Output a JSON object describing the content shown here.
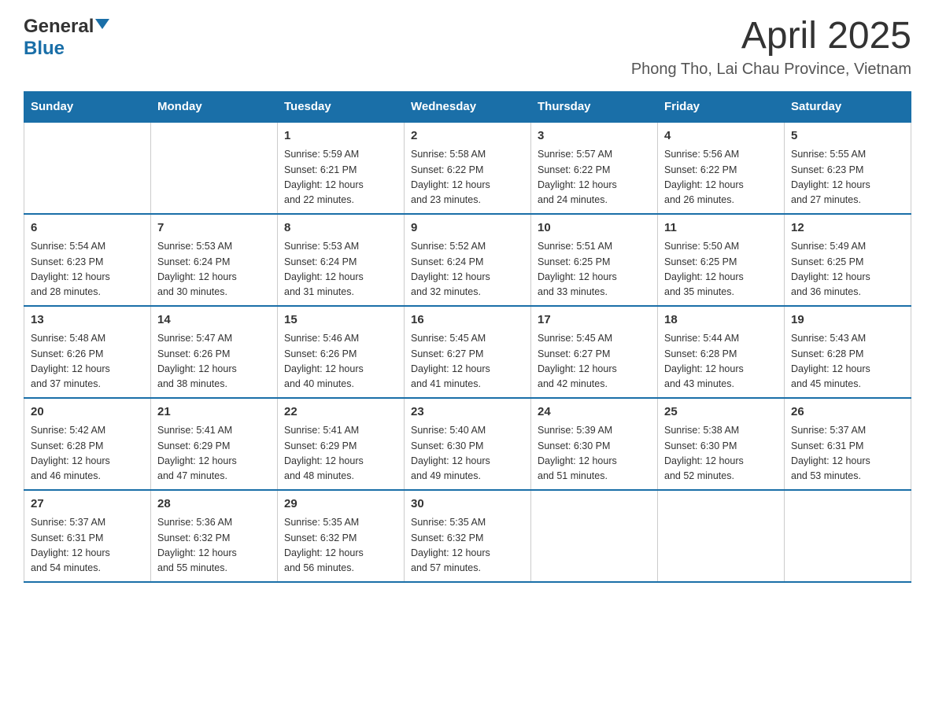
{
  "header": {
    "logo_general": "General",
    "logo_blue": "Blue",
    "title": "April 2025",
    "subtitle": "Phong Tho, Lai Chau Province, Vietnam"
  },
  "days_of_week": [
    "Sunday",
    "Monday",
    "Tuesday",
    "Wednesday",
    "Thursday",
    "Friday",
    "Saturday"
  ],
  "weeks": [
    {
      "days": [
        {
          "number": "",
          "info": ""
        },
        {
          "number": "",
          "info": ""
        },
        {
          "number": "1",
          "info": "Sunrise: 5:59 AM\nSunset: 6:21 PM\nDaylight: 12 hours\nand 22 minutes."
        },
        {
          "number": "2",
          "info": "Sunrise: 5:58 AM\nSunset: 6:22 PM\nDaylight: 12 hours\nand 23 minutes."
        },
        {
          "number": "3",
          "info": "Sunrise: 5:57 AM\nSunset: 6:22 PM\nDaylight: 12 hours\nand 24 minutes."
        },
        {
          "number": "4",
          "info": "Sunrise: 5:56 AM\nSunset: 6:22 PM\nDaylight: 12 hours\nand 26 minutes."
        },
        {
          "number": "5",
          "info": "Sunrise: 5:55 AM\nSunset: 6:23 PM\nDaylight: 12 hours\nand 27 minutes."
        }
      ]
    },
    {
      "days": [
        {
          "number": "6",
          "info": "Sunrise: 5:54 AM\nSunset: 6:23 PM\nDaylight: 12 hours\nand 28 minutes."
        },
        {
          "number": "7",
          "info": "Sunrise: 5:53 AM\nSunset: 6:24 PM\nDaylight: 12 hours\nand 30 minutes."
        },
        {
          "number": "8",
          "info": "Sunrise: 5:53 AM\nSunset: 6:24 PM\nDaylight: 12 hours\nand 31 minutes."
        },
        {
          "number": "9",
          "info": "Sunrise: 5:52 AM\nSunset: 6:24 PM\nDaylight: 12 hours\nand 32 minutes."
        },
        {
          "number": "10",
          "info": "Sunrise: 5:51 AM\nSunset: 6:25 PM\nDaylight: 12 hours\nand 33 minutes."
        },
        {
          "number": "11",
          "info": "Sunrise: 5:50 AM\nSunset: 6:25 PM\nDaylight: 12 hours\nand 35 minutes."
        },
        {
          "number": "12",
          "info": "Sunrise: 5:49 AM\nSunset: 6:25 PM\nDaylight: 12 hours\nand 36 minutes."
        }
      ]
    },
    {
      "days": [
        {
          "number": "13",
          "info": "Sunrise: 5:48 AM\nSunset: 6:26 PM\nDaylight: 12 hours\nand 37 minutes."
        },
        {
          "number": "14",
          "info": "Sunrise: 5:47 AM\nSunset: 6:26 PM\nDaylight: 12 hours\nand 38 minutes."
        },
        {
          "number": "15",
          "info": "Sunrise: 5:46 AM\nSunset: 6:26 PM\nDaylight: 12 hours\nand 40 minutes."
        },
        {
          "number": "16",
          "info": "Sunrise: 5:45 AM\nSunset: 6:27 PM\nDaylight: 12 hours\nand 41 minutes."
        },
        {
          "number": "17",
          "info": "Sunrise: 5:45 AM\nSunset: 6:27 PM\nDaylight: 12 hours\nand 42 minutes."
        },
        {
          "number": "18",
          "info": "Sunrise: 5:44 AM\nSunset: 6:28 PM\nDaylight: 12 hours\nand 43 minutes."
        },
        {
          "number": "19",
          "info": "Sunrise: 5:43 AM\nSunset: 6:28 PM\nDaylight: 12 hours\nand 45 minutes."
        }
      ]
    },
    {
      "days": [
        {
          "number": "20",
          "info": "Sunrise: 5:42 AM\nSunset: 6:28 PM\nDaylight: 12 hours\nand 46 minutes."
        },
        {
          "number": "21",
          "info": "Sunrise: 5:41 AM\nSunset: 6:29 PM\nDaylight: 12 hours\nand 47 minutes."
        },
        {
          "number": "22",
          "info": "Sunrise: 5:41 AM\nSunset: 6:29 PM\nDaylight: 12 hours\nand 48 minutes."
        },
        {
          "number": "23",
          "info": "Sunrise: 5:40 AM\nSunset: 6:30 PM\nDaylight: 12 hours\nand 49 minutes."
        },
        {
          "number": "24",
          "info": "Sunrise: 5:39 AM\nSunset: 6:30 PM\nDaylight: 12 hours\nand 51 minutes."
        },
        {
          "number": "25",
          "info": "Sunrise: 5:38 AM\nSunset: 6:30 PM\nDaylight: 12 hours\nand 52 minutes."
        },
        {
          "number": "26",
          "info": "Sunrise: 5:37 AM\nSunset: 6:31 PM\nDaylight: 12 hours\nand 53 minutes."
        }
      ]
    },
    {
      "days": [
        {
          "number": "27",
          "info": "Sunrise: 5:37 AM\nSunset: 6:31 PM\nDaylight: 12 hours\nand 54 minutes."
        },
        {
          "number": "28",
          "info": "Sunrise: 5:36 AM\nSunset: 6:32 PM\nDaylight: 12 hours\nand 55 minutes."
        },
        {
          "number": "29",
          "info": "Sunrise: 5:35 AM\nSunset: 6:32 PM\nDaylight: 12 hours\nand 56 minutes."
        },
        {
          "number": "30",
          "info": "Sunrise: 5:35 AM\nSunset: 6:32 PM\nDaylight: 12 hours\nand 57 minutes."
        },
        {
          "number": "",
          "info": ""
        },
        {
          "number": "",
          "info": ""
        },
        {
          "number": "",
          "info": ""
        }
      ]
    }
  ]
}
